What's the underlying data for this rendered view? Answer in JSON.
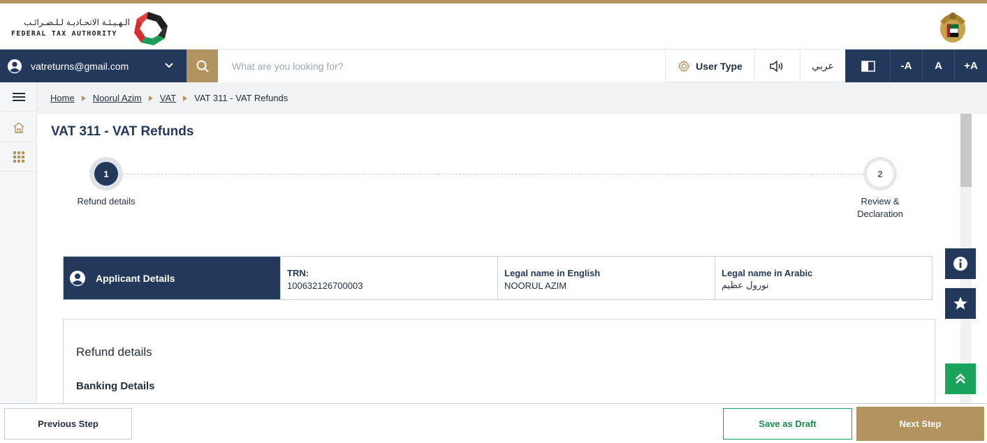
{
  "header": {
    "logo_arabic": "الـهـيـئـة الاتحـاديـة لـلـضـرائـب",
    "logo_english": "FEDERAL TAX AUTHORITY"
  },
  "toolbar": {
    "user_email": "vatreturns@gmail.com",
    "search_placeholder": "What are you looking for?",
    "user_type_label": "User Type",
    "language_label": "عربي",
    "font_decrease": "-A",
    "font_normal": "A",
    "font_increase": "+A"
  },
  "breadcrumb": {
    "items": [
      "Home",
      "Noorul Azim",
      "VAT"
    ],
    "current": "VAT 311 - VAT Refunds"
  },
  "page": {
    "title": "VAT 311 - VAT Refunds"
  },
  "stepper": {
    "steps": [
      {
        "number": "1",
        "label": "Refund details",
        "state": "active"
      },
      {
        "number": "2",
        "label": "Review & Declaration",
        "state": "pending"
      }
    ]
  },
  "applicant": {
    "heading": "Applicant Details",
    "trn_label": "TRN:",
    "trn_value": "100632126700003",
    "name_en_label": "Legal name in English",
    "name_en_value": "NOORUL AZIM",
    "name_ar_label": "Legal name in Arabic",
    "name_ar_value": "نورول عظيم"
  },
  "refund": {
    "section_title": "Refund details",
    "subsection_title": "Banking Details"
  },
  "footer": {
    "previous": "Previous Step",
    "save_draft": "Save as Draft",
    "next": "Next Step"
  },
  "colors": {
    "navy": "#23395b",
    "gold": "#b3945e",
    "green": "#1aa35a"
  }
}
